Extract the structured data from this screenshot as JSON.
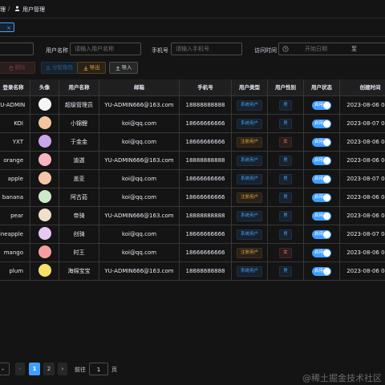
{
  "breadcrumb": {
    "parent": "理",
    "separator": "/",
    "current": "用户管理"
  },
  "tags": [
    {
      "label": "×"
    }
  ],
  "filters": {
    "nickname_label": "用户名称",
    "nickname_placeholder": "请输入用户名称",
    "phone_label": "手机号",
    "phone_placeholder": "请输入手机号",
    "time_label": "访问时间",
    "start_placeholder": "开始日期",
    "range_separator": "至"
  },
  "toolbar": {
    "delete_label": "删除",
    "assign_label": "分配角色",
    "export_label": "导出",
    "import_label": "导入"
  },
  "table": {
    "columns": [
      "登录名称",
      "头像",
      "用户名称",
      "邮箱",
      "手机号",
      "用户类型",
      "用户性别",
      "用户状态",
      "创建时间"
    ],
    "rows": [
      {
        "login": "YU-ADMIN",
        "name": "超级管理员",
        "email": "YU-ADMIN666@163.com",
        "phone": "18888888888",
        "type": "系统用户",
        "gender": "男",
        "status": "启用",
        "created": "2023-08-06 04:0"
      },
      {
        "login": "KOI",
        "name": "小锦鲤",
        "email": "koi@qq.com",
        "phone": "18666666666",
        "type": "系统用户",
        "gender": "男",
        "status": "启用",
        "created": "2023-08-07 04:0"
      },
      {
        "login": "YXT",
        "name": "于金金",
        "email": "koi@qq.com",
        "phone": "18666666666",
        "type": "注册用户",
        "gender": "女",
        "status": "启用",
        "created": "2023-08-06 04:0"
      },
      {
        "login": "orange",
        "name": "迪迦",
        "email": "YU-ADMIN666@163.com",
        "phone": "18888888888",
        "type": "系统用户",
        "gender": "男",
        "status": "启用",
        "created": "2023-08-06 04:0"
      },
      {
        "login": "apple",
        "name": "盖亚",
        "email": "koi@qq.com",
        "phone": "18666666666",
        "type": "系统用户",
        "gender": "男",
        "status": "启用",
        "created": "2023-08-07 04:0"
      },
      {
        "login": "banana",
        "name": "阿古茹",
        "email": "koi@qq.com",
        "phone": "18666666666",
        "type": "注册用户",
        "gender": "男",
        "status": "启用",
        "created": "2023-08-06 04:0"
      },
      {
        "login": "pear",
        "name": "帝骑",
        "email": "YU-ADMIN666@163.com",
        "phone": "18888888888",
        "type": "系统用户",
        "gender": "男",
        "status": "启用",
        "created": "2023-08-06 04:0"
      },
      {
        "login": "ineapple",
        "name": "创骑",
        "email": "koi@qq.com",
        "phone": "18666666666",
        "type": "系统用户",
        "gender": "男",
        "status": "启用",
        "created": "2023-08-07 04:0"
      },
      {
        "login": "mango",
        "name": "时王",
        "email": "koi@qq.com",
        "phone": "18666666666",
        "type": "注册用户",
        "gender": "女",
        "status": "启用",
        "created": "2023-08-06 04:0"
      },
      {
        "login": "plum",
        "name": "海绵宝宝",
        "email": "YU-ADMIN666@163.com",
        "phone": "18888888888",
        "type": "系统用户",
        "gender": "男",
        "status": "启用",
        "created": "2023-08-06 04:0"
      }
    ]
  },
  "avatar_colors": [
    "#f5f5f5",
    "#f0c7a0",
    "#c9a6e8",
    "#f7b5c0",
    "#f5c6a5",
    "#cfe8c9",
    "#f0e0c8",
    "#e8c8f0",
    "#f5a0a0",
    "#f7e06a"
  ],
  "pagination": {
    "pages": [
      "1",
      "2"
    ],
    "active": "1",
    "goto_label": "前往",
    "goto_value": "1",
    "page_suffix": "页",
    "prev": "‹",
    "next": "›"
  },
  "watermark": "@稀土掘金技术社区",
  "colors": {
    "primary": "#409eff",
    "warning": "#e6a23c",
    "danger": "#f56c6c",
    "background": "#141414"
  }
}
